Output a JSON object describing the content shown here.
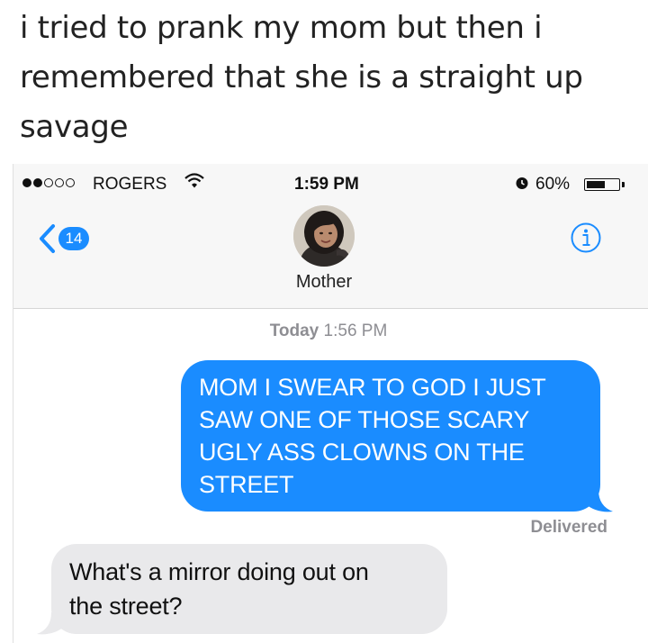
{
  "caption": {
    "line1": "i tried to prank my mom but then i",
    "line2": "remembered that she is a straight up",
    "line3": "savage"
  },
  "status_bar": {
    "signal_bars_filled": 2,
    "signal_bars_total": 5,
    "carrier": "ROGERS",
    "time": "1:59 PM",
    "battery_percent": "60%",
    "battery_level": 0.6,
    "icons": [
      "signal-dots-icon",
      "wifi-icon",
      "alarm-clock-icon",
      "battery-icon"
    ]
  },
  "nav": {
    "back_badge": "14",
    "contact_name": "Mother",
    "icons": [
      "back-chevron-icon",
      "info-icon"
    ]
  },
  "thread": {
    "timestamp_day": "Today",
    "timestamp_time": "1:56 PM",
    "messages": [
      {
        "direction": "outgoing",
        "lines": [
          "MOM I SWEAR TO GOD I JUST",
          "SAW ONE OF THOSE SCARY",
          "UGLY ASS CLOWNS ON THE",
          "STREET"
        ],
        "status": "Delivered"
      },
      {
        "direction": "incoming",
        "lines": [
          "What's a mirror doing out on",
          "the street?"
        ]
      }
    ]
  },
  "colors": {
    "imessage_blue": "#1a8cff",
    "incoming_gray": "#e9e9eb",
    "meta_gray": "#8e8e93",
    "header_bg": "#f7f7f7"
  }
}
